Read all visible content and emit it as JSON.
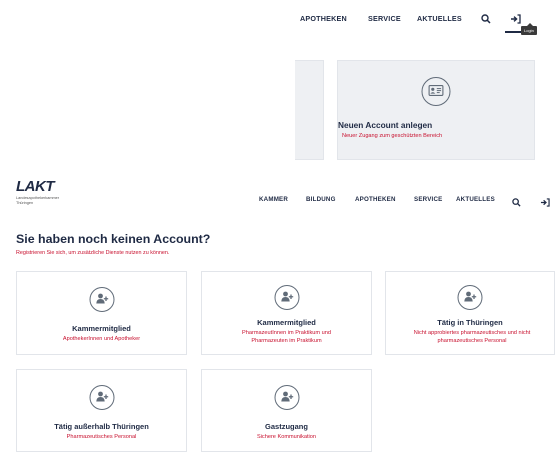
{
  "top_nav": {
    "items": [
      "APOTHEKEN",
      "SERVICE",
      "AKTUELLES"
    ],
    "tooltip": "Login"
  },
  "new_account_card": {
    "title": "Neuen Account anlegen",
    "subtitle": "Neuer Zugang zum geschützten Bereich"
  },
  "header": {
    "logo_text": "LAKT",
    "logo_sub_1": "Landesapothekerkammer",
    "logo_sub_2": "Thüringen",
    "nav_items": [
      "KAMMER",
      "BILDUNG",
      "APOTHEKEN",
      "SERVICE",
      "AKTUELLES"
    ]
  },
  "page": {
    "title": "Sie haben noch keinen Account?",
    "subtitle": "Registrieren Sie sich, um zusätzliche Dienste nutzen zu können."
  },
  "cards": [
    {
      "title": "Kammermitglied",
      "subtitle": "ApothekerInnen und Apotheker"
    },
    {
      "title": "Kammermitglied",
      "subtitle": "PharmazeutInnen im Praktikum und Pharmazeuten im Praktikum"
    },
    {
      "title": "Tätig in Thüringen",
      "subtitle": "Nicht approbiertes pharmazeutisches und nicht pharmazeutisches Personal"
    },
    {
      "title": "Tätig außerhalb Thüringen",
      "subtitle": "Pharmazeutisches Personal"
    },
    {
      "title": "Gastzugang",
      "subtitle": "Sichere Kommunikation"
    }
  ],
  "colors": {
    "primary": "#1f2a44",
    "accent": "#c8102e",
    "panel_bg": "#eef0f3"
  }
}
